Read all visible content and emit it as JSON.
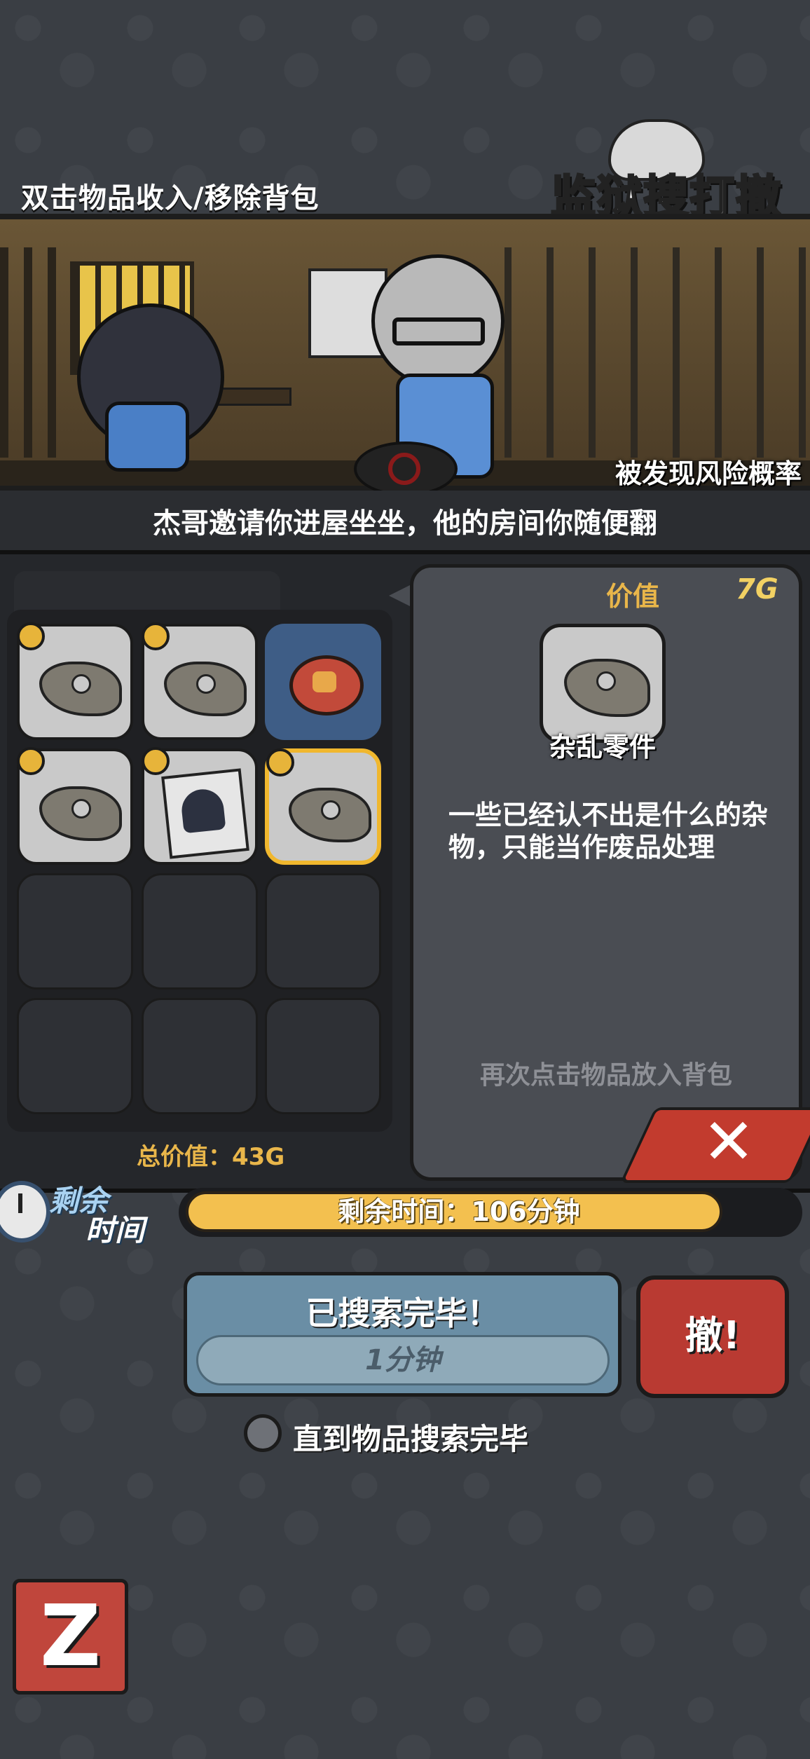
{
  "header": {
    "hint": "双击物品收入/移除背包",
    "logo": "监狱搜打撤"
  },
  "scene": {
    "risk_label": "被发现风险概率",
    "subtitle": "杰哥邀请你进屋坐坐，他的房间你随便翻"
  },
  "inventory": {
    "slots": [
      {
        "item": "杂乱零件",
        "icon": "scrap-parts-icon",
        "coin": true
      },
      {
        "item": "杂乱零件",
        "icon": "scrap-parts-icon",
        "coin": true
      },
      {
        "item": "badge",
        "icon": "red-badge-icon",
        "coin": false
      },
      {
        "item": "杂乱零件",
        "icon": "scrap-parts-icon",
        "coin": true
      },
      {
        "item": "magazine",
        "icon": "magazine-icon",
        "coin": true
      },
      {
        "item": "杂乱零件",
        "icon": "scrap-parts-icon",
        "coin": true,
        "selected": true
      },
      {
        "empty": true
      },
      {
        "empty": true
      },
      {
        "empty": true
      },
      {
        "empty": true
      },
      {
        "empty": true
      },
      {
        "empty": true
      }
    ],
    "total_label": "总价值：43G"
  },
  "detail": {
    "value_label": "价值",
    "value": "7G",
    "item_name": "杂乱零件",
    "description": "一些已经认不出是什么的杂物，只能当作废品处理",
    "hint": "再次点击物品放入背包",
    "close_glyph": "✕"
  },
  "timer": {
    "label_top": "剩余",
    "label_bottom": "时间",
    "text": "剩余时间：106分钟",
    "remaining_fraction": 0.88
  },
  "actions": {
    "search_title": "已搜索完毕！",
    "search_sub": "1分钟",
    "withdraw": "撤!",
    "until_label": "直到物品搜索完毕",
    "back_glyph": "Z"
  },
  "colors": {
    "accent_gold": "#f3c04f",
    "danger_red": "#c0463c",
    "panel": "#4a4d53"
  }
}
